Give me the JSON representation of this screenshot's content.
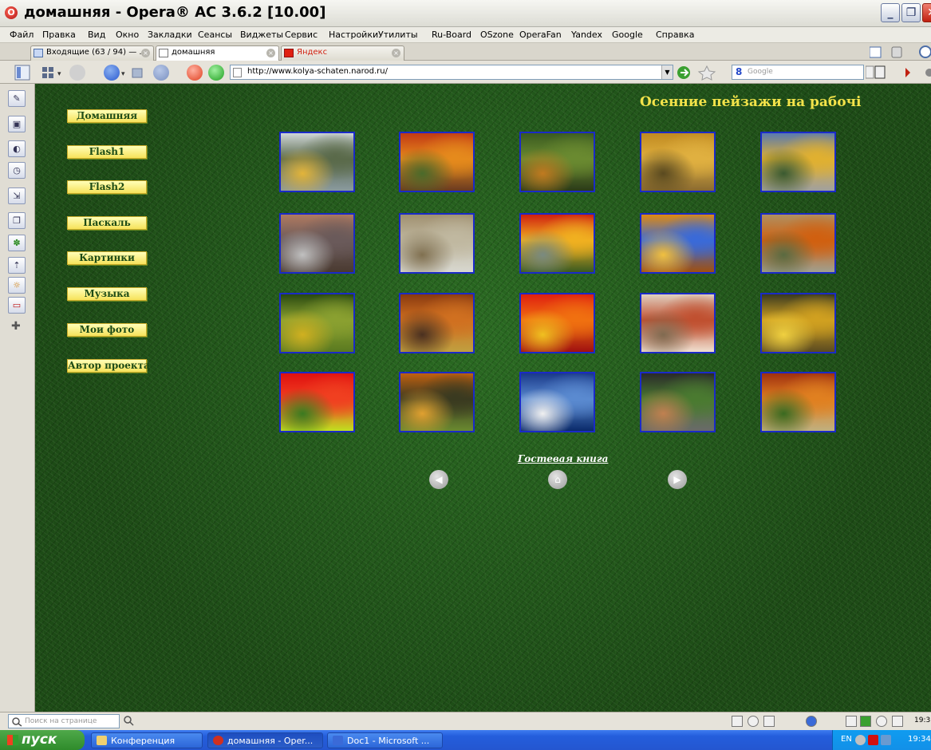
{
  "window": {
    "title": "домашняя - Opera® AC 3.6.2 [10.00]"
  },
  "menu": [
    "Файл",
    "Правка",
    "Вид",
    "Окно",
    "Закладки",
    "Сеансы",
    "Виджеты",
    "Сервис",
    "Настройки",
    "Утилиты",
    "Ru-Board",
    "OSzone",
    "OperaFan",
    "Yandex",
    "Google",
    "Справка"
  ],
  "tabs": [
    {
      "label": "Входящие (63 / 94) — ..."
    },
    {
      "label": "домашняя"
    },
    {
      "label": "Яндекс"
    }
  ],
  "address": {
    "url": "http://www.kolya-schaten.narod.ru/",
    "search_engine": "Google"
  },
  "page": {
    "heading": "Осенние пейзажи на рабочi",
    "nav": [
      "Домашняя",
      "Flash1",
      "Flash2",
      "Паскаль",
      "Картинки",
      "Музыка",
      "Мои фото",
      "Автор проекта"
    ],
    "guestbook": "Гостевая книга",
    "thumbnails": [
      {
        "palette": [
          "#cfd6d8",
          "#5a6a4a",
          "#e2b43a",
          "#8a9aa0"
        ]
      },
      {
        "palette": [
          "#c23a14",
          "#e58a1c",
          "#4a6a2a",
          "#6a3a20"
        ]
      },
      {
        "palette": [
          "#3a5a20",
          "#6a8a30",
          "#c07a20",
          "#2a3a18"
        ]
      },
      {
        "palette": [
          "#c08a20",
          "#e0b040",
          "#5a4a20",
          "#8a6a30"
        ]
      },
      {
        "palette": [
          "#5a7ab0",
          "#e0b030",
          "#3a5a30",
          "#a0a0a0"
        ]
      },
      {
        "palette": [
          "#b07a60",
          "#6a5a5a",
          "#c0c0c0",
          "#4a3a30"
        ]
      },
      {
        "palette": [
          "#a09070",
          "#c0b8a0",
          "#807050",
          "#d8d8d0"
        ]
      },
      {
        "palette": [
          "#d02010",
          "#f0b020",
          "#7a8a80",
          "#3a5a20"
        ]
      },
      {
        "palette": [
          "#e08a10",
          "#3a6ad8",
          "#f0c040",
          "#a05010"
        ]
      },
      {
        "palette": [
          "#b09060",
          "#d06010",
          "#5a6a40",
          "#a0a090"
        ]
      },
      {
        "palette": [
          "#2a4a10",
          "#8aa030",
          "#d0b020",
          "#5a7a20"
        ]
      },
      {
        "palette": [
          "#8a3a10",
          "#d07020",
          "#4a3020",
          "#c0a040"
        ]
      },
      {
        "palette": [
          "#e02010",
          "#f07010",
          "#f0c020",
          "#a01010"
        ]
      },
      {
        "palette": [
          "#e0d0c0",
          "#c05030",
          "#806a50",
          "#f0e0d0"
        ]
      },
      {
        "palette": [
          "#3a3a20",
          "#d0a020",
          "#f0d040",
          "#5a4a20"
        ]
      },
      {
        "palette": [
          "#e01010",
          "#f04020",
          "#3a7a20",
          "#c0e020"
        ]
      },
      {
        "palette": [
          "#c06010",
          "#3a3a20",
          "#e0a030",
          "#6a8a30"
        ]
      },
      {
        "palette": [
          "#1a3a8a",
          "#5a8ad0",
          "#f0f0f0",
          "#0a2a6a"
        ]
      },
      {
        "palette": [
          "#2a2a2a",
          "#4a7a30",
          "#c08050",
          "#6a6a6a"
        ]
      },
      {
        "palette": [
          "#a03010",
          "#e08020",
          "#3a6a20",
          "#c0b080"
        ]
      }
    ]
  },
  "findbar": {
    "placeholder": "Поиск на странице",
    "time": "19:3"
  },
  "taskbar": {
    "start": "пуск",
    "items": [
      {
        "label": "Конференция",
        "icon_color": "#f0d070"
      },
      {
        "label": "домашняя - Oper...",
        "icon_color": "#d03020"
      },
      {
        "label": "Doc1 - Microsoft ...",
        "icon_color": "#3a6ad8"
      }
    ],
    "lang": "EN",
    "clock": "19:34"
  }
}
